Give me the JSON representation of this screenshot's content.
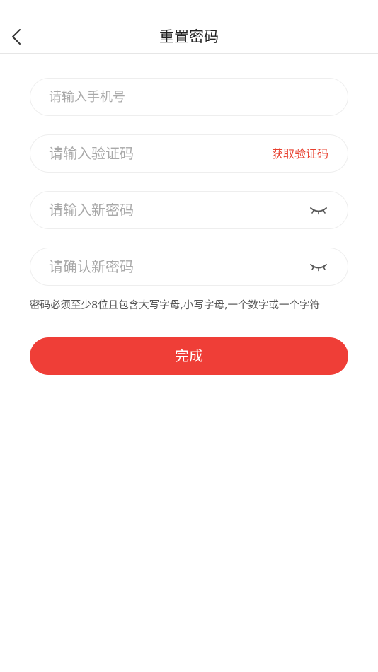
{
  "header": {
    "title": "重置密码",
    "back_icon": "chevron-left-icon"
  },
  "form": {
    "phone": {
      "placeholder": "请输入手机号",
      "value": ""
    },
    "code": {
      "placeholder": "请输入验证码",
      "value": "",
      "action_label": "获取验证码"
    },
    "new_password": {
      "placeholder": "请输入新密码",
      "value": "",
      "toggle_icon": "eye-closed-icon"
    },
    "confirm_password": {
      "placeholder": "请确认新密码",
      "value": "",
      "toggle_icon": "eye-closed-icon"
    },
    "hint": "密码必须至少8位且包含大写字母,小写字母,一个数字或一个字符",
    "submit_label": "完成"
  },
  "colors": {
    "accent": "#ef3e37",
    "link": "#e8402f",
    "placeholder": "#a8a8a8",
    "border": "#eeeeee"
  }
}
